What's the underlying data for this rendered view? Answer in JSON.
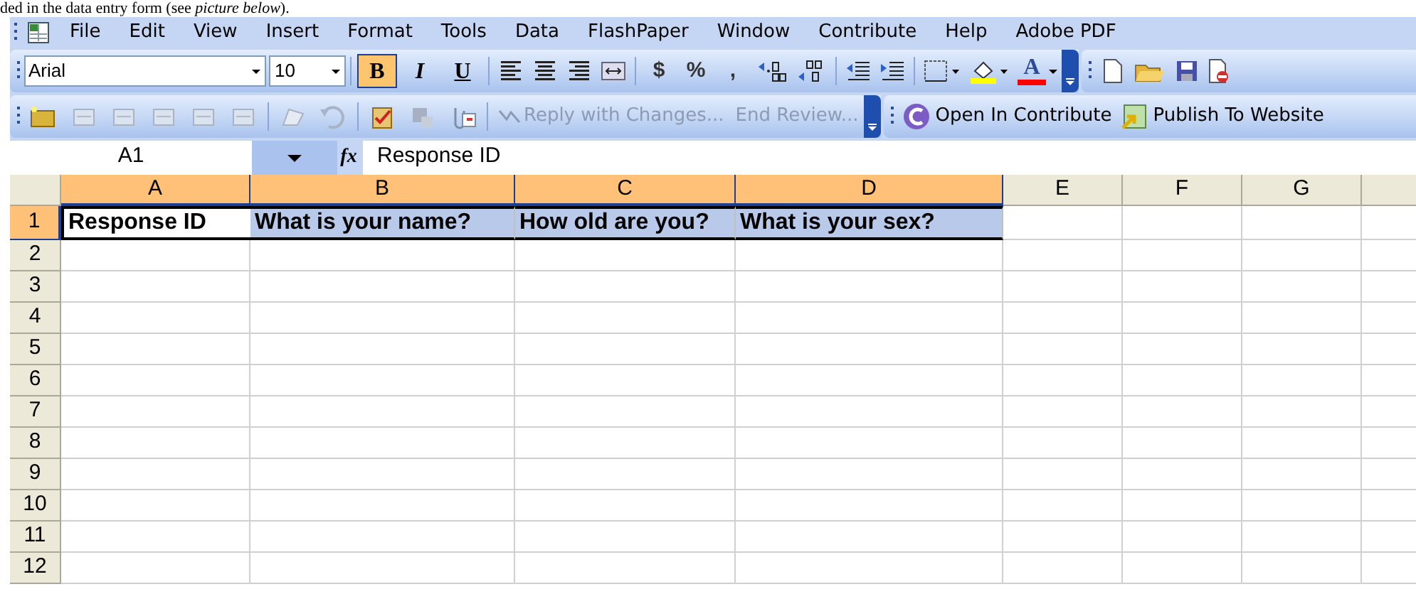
{
  "caption": "ded in the data entry form (see *picture below*).",
  "menu_bar": {
    "items": [
      "File",
      "Edit",
      "View",
      "Insert",
      "Format",
      "Tools",
      "Data",
      "FlashPaper",
      "Window",
      "Contribute",
      "Help",
      "Adobe PDF"
    ]
  },
  "formatting_toolbar": {
    "font": "Arial",
    "size": "10",
    "styles": [
      {
        "label": "B",
        "selected": true
      },
      {
        "label": "I",
        "selected": false
      },
      {
        "label": "U",
        "selected": false
      }
    ],
    "number_buttons": [
      "$",
      "%",
      ","
    ],
    "font_color_label": "A"
  },
  "review_toolbar": {
    "items": [
      {
        "label": "Reply with Changes...",
        "disabled": true
      },
      {
        "label": "End Review...",
        "disabled": true
      }
    ]
  },
  "contribute_toolbar": {
    "items": [
      "Open In Contribute",
      "Publish To Website"
    ]
  },
  "formula_bar": {
    "name_box": "A1",
    "fx": "fx",
    "value": "Response ID"
  },
  "grid": {
    "columns": [
      {
        "label": "A",
        "selected": true
      },
      {
        "label": "B",
        "selected": true
      },
      {
        "label": "C",
        "selected": true
      },
      {
        "label": "D",
        "selected": true
      },
      {
        "label": "E",
        "selected": false
      },
      {
        "label": "F",
        "selected": false
      },
      {
        "label": "G",
        "selected": false
      }
    ],
    "rows": [
      {
        "label": "1",
        "selected": true,
        "cells": [
          {
            "text": "Response ID",
            "highlighted": false
          },
          {
            "text": "What is your name?",
            "highlighted": true
          },
          {
            "text": "How old are you?",
            "highlighted": true
          },
          {
            "text": "What is your sex?",
            "highlighted": true
          }
        ]
      },
      {
        "label": "2",
        "selected": false
      },
      {
        "label": "3",
        "selected": false
      },
      {
        "label": "4",
        "selected": false
      },
      {
        "label": "5",
        "selected": false
      },
      {
        "label": "6",
        "selected": false
      },
      {
        "label": "7",
        "selected": false
      },
      {
        "label": "8",
        "selected": false
      },
      {
        "label": "9",
        "selected": false
      },
      {
        "label": "10",
        "selected": false
      },
      {
        "label": "11",
        "selected": false
      },
      {
        "label": "12",
        "selected": false
      }
    ]
  }
}
